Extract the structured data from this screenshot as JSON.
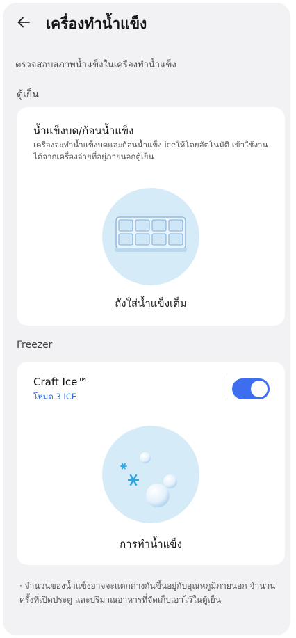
{
  "header": {
    "title": "เครื่องทำน้ำแข็ง",
    "back_icon": "arrow-left-icon"
  },
  "subtitle": "ตรวจสอบสภาพน้ำแข็งในเครื่องทำน้ำแข็ง",
  "fridge_section": {
    "label": "ตู้เย็น",
    "card": {
      "title": "น้ำแข็งบด/ก้อนน้ำแข็ง",
      "description": "เครื่องจะทำน้ำแข็งบดและก้อนน้ำแข็ง iceให้โดยอัตโนมัติ เข้าใช้งานได้จากเครื่องจ่ายที่อยู่ภายนอกตู้เย็น",
      "icon": "ice-tray-icon",
      "status": "ถังใส่น้ำแข็งเต็ม"
    }
  },
  "freezer_section": {
    "label": "Freezer",
    "card": {
      "title": "Craft Ice™",
      "mode": "โหมด 3 ICE",
      "toggle_on": true,
      "icon": "ice-balls-icon",
      "status": "การทำน้ำแข็ง"
    }
  },
  "footnote": "· จำนวนของน้ำแข็งอาจจะแตกต่างกันขึ้นอยู่กับอุณหภูมิภายนอก จำนวนครั้งที่เปิดประตู และปริมาณอาหารที่จัดเก็บเอาไว้ในตู้เย็น",
  "colors": {
    "accent": "#3d6ef0",
    "mode_text": "#2f6fdc",
    "illus_bg": "#d6ebf8",
    "page_bg": "#f2f2f4"
  }
}
